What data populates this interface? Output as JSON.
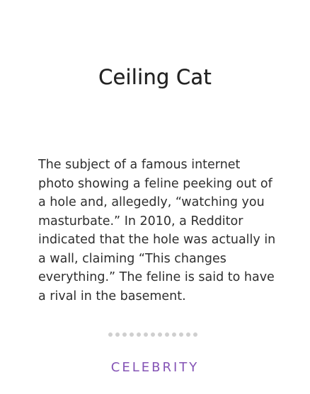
{
  "card": {
    "title": "Ceiling Cat",
    "definition": "The subject of a famous internet photo showing a feline peeking out of a hole and, allegedly, “watching you masturbate.” In 2010, a Redditor indicated that the hole was actually in a wall, claiming “This changes everything.” The feline is said to have a rival in the basement.",
    "category": "CELEBRITY",
    "pagination_dots": 13
  },
  "colors": {
    "category": "#8453b5",
    "dots": "#cfcfcf",
    "text": "#2e2e2e"
  }
}
